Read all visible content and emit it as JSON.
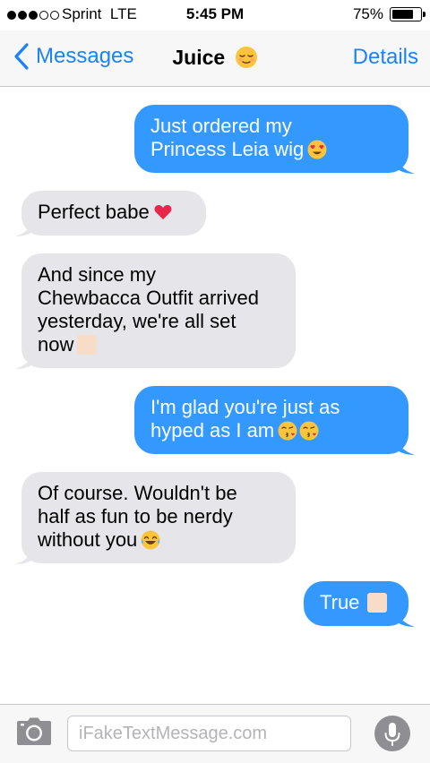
{
  "status_bar": {
    "carrier": "Sprint",
    "network": "LTE",
    "time": "5:45 PM",
    "battery": "75%",
    "battery_level": 0.75,
    "signal_bars_filled": 3,
    "signal_bars_total": 5
  },
  "nav": {
    "back_label": "Messages",
    "contact_name": "Juice",
    "contact_emoji": "relieved-face-icon",
    "details_label": "Details",
    "accent_color": "#1a82fb"
  },
  "messages": [
    {
      "direction": "sent",
      "lines": [
        "Just ordered my",
        "Princess Leia wig"
      ],
      "emoji": [
        "heart-eyes-icon"
      ]
    },
    {
      "direction": "received",
      "lines": [
        "Perfect babe"
      ],
      "emoji": [
        "red-heart-icon"
      ]
    },
    {
      "direction": "received",
      "lines": [
        "And since my",
        "Chewbacca Outfit arrived",
        "yesterday, we're all set",
        "now"
      ],
      "emoji": [
        "unrendered-emoji-box"
      ]
    },
    {
      "direction": "sent",
      "lines": [
        "I'm glad you're just as",
        "hyped as I am"
      ],
      "emoji": [
        "kissing-face-icon",
        "kissing-face-icon"
      ]
    },
    {
      "direction": "received",
      "lines": [
        "Of course. Wouldn't be",
        "half as fun to be nerdy",
        "without you"
      ],
      "emoji": [
        "tears-of-joy-icon"
      ]
    },
    {
      "direction": "sent",
      "lines": [
        "True"
      ],
      "emoji": [
        "unrendered-emoji-box"
      ]
    }
  ],
  "input": {
    "placeholder": "iFakeTextMessage.com",
    "value": ""
  },
  "colors": {
    "sent_bubble": "#3399ff",
    "received_bubble": "#e5e5ea"
  }
}
